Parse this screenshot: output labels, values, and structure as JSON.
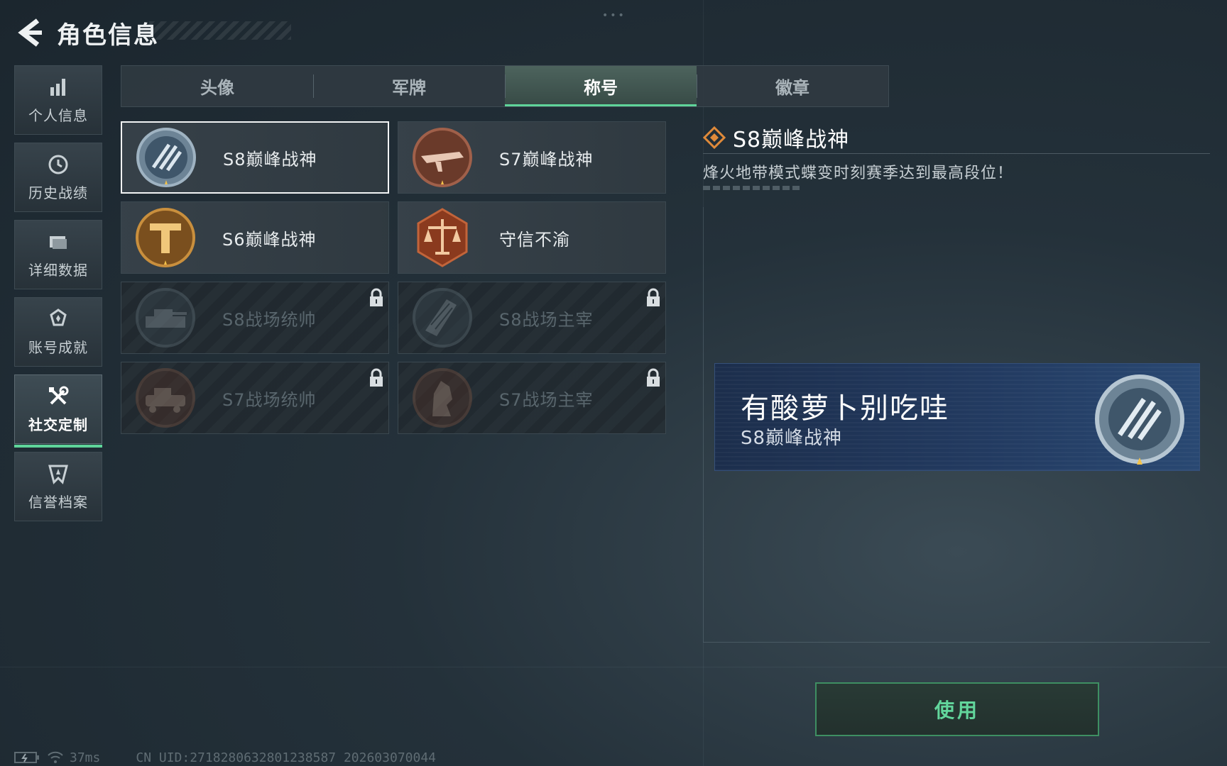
{
  "header": {
    "title": "角色信息"
  },
  "sidebar": {
    "items": [
      {
        "label": "个人信息",
        "icon": "bar-chart-icon"
      },
      {
        "label": "历史战绩",
        "icon": "clock-history-icon"
      },
      {
        "label": "详细数据",
        "icon": "folder-icon"
      },
      {
        "label": "账号成就",
        "icon": "medal-icon"
      },
      {
        "label": "社交定制",
        "icon": "tools-icon",
        "active": true
      },
      {
        "label": "信誉档案",
        "icon": "shield-icon"
      }
    ]
  },
  "tabs": [
    {
      "label": "头像"
    },
    {
      "label": "军牌"
    },
    {
      "label": "称号",
      "active": true
    },
    {
      "label": "徽章"
    }
  ],
  "titles": [
    {
      "name": "S8巅峰战神",
      "locked": false,
      "selected": true,
      "badge": "s8-peak-badge-icon"
    },
    {
      "name": "S7巅峰战神",
      "locked": false,
      "selected": false,
      "badge": "s7-peak-badge-icon"
    },
    {
      "name": "S6巅峰战神",
      "locked": false,
      "selected": false,
      "badge": "s6-peak-badge-icon"
    },
    {
      "name": "守信不渝",
      "locked": false,
      "selected": false,
      "badge": "scales-badge-icon"
    },
    {
      "name": "S8战场统帅",
      "locked": true,
      "selected": false,
      "badge": "tank-badge-icon"
    },
    {
      "name": "S8战场主宰",
      "locked": true,
      "selected": false,
      "badge": "building-badge-icon"
    },
    {
      "name": "S7战场统帅",
      "locked": true,
      "selected": false,
      "badge": "vehicle-badge-icon"
    },
    {
      "name": "S7战场主宰",
      "locked": true,
      "selected": false,
      "badge": "knight-badge-icon"
    }
  ],
  "detail": {
    "name": "S8巅峰战神",
    "description": "烽火地带模式蝶变时刻赛季达到最高段位！"
  },
  "preview": {
    "player_name": "有酸萝卜别吃哇",
    "title": "S8巅峰战神"
  },
  "actions": {
    "use_label": "使用"
  },
  "status": {
    "ping": "37ms",
    "uid": "CN UID:2718280632801238587 202603070044"
  },
  "colors": {
    "accent": "#5fd49a",
    "namecard": "#223a60",
    "use_text": "#62d69c"
  }
}
